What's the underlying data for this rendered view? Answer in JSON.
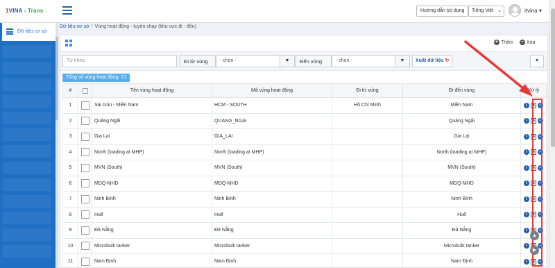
{
  "app": {
    "logo_prefix": "1",
    "logo_main": "VINA",
    "logo_suffix": "- Trans"
  },
  "header": {
    "guide_label": "Hướng dẫn sử dụng",
    "language": "Tiếng Việt",
    "username": "itvina",
    "username_caret": "▾"
  },
  "sidebar": {
    "active_label": "Dữ liệu cơ sở"
  },
  "breadcrumb": {
    "items": [
      "Dữ liệu cơ sở",
      "Vùng hoạt động - tuyến chạy (khu vực đi - đến)"
    ],
    "separator": "/"
  },
  "toolbar": {
    "add_label": "Thêm",
    "delete_label": "Xóa"
  },
  "filters": {
    "keyword_placeholder": "Từ khóa",
    "from_label": "Đi từ vùng",
    "from_value": "- chọn -",
    "to_label": "Đến vùng",
    "to_value": "- chọn -",
    "export_label": "Xuất dữ liệu"
  },
  "total_label": "Tổng số vùng hoạt động: 21",
  "table": {
    "headers": [
      "#",
      "",
      "Tên vùng hoạt động",
      "Mã vùng hoạt động",
      "Đi từ vùng",
      "Đi đến vùng",
      "Xử lý"
    ],
    "rows": [
      {
        "num": "1",
        "name": "Sài Gòn - Miền Nam",
        "code": "HCM - SOUTH",
        "from": "Hồ Chí Minh",
        "to": "Miền Nam"
      },
      {
        "num": "2",
        "name": "Quảng Ngãi",
        "code": "QUANG_NGAI",
        "from": "",
        "to": "Quảng Ngãi"
      },
      {
        "num": "3",
        "name": "Gia Lai",
        "code": "GIA_LAI",
        "from": "",
        "to": "Gia Lai"
      },
      {
        "num": "4",
        "name": "North (loading at MHP)",
        "code": "North (loading at MHP)",
        "from": "",
        "to": "North (loading at MHP)"
      },
      {
        "num": "5",
        "name": "MVN (South)",
        "code": "MVN (South)",
        "from": "",
        "to": "MVN (South)"
      },
      {
        "num": "6",
        "name": "MDQ-MHD",
        "code": "MDQ-MHD",
        "from": "",
        "to": "MDQ-MHD"
      },
      {
        "num": "7",
        "name": "Ninh Bình",
        "code": "Ninh Bình",
        "from": "",
        "to": "Ninh Bình"
      },
      {
        "num": "8",
        "name": "Huế",
        "code": "Huế",
        "from": "",
        "to": "Huế"
      },
      {
        "num": "9",
        "name": "Đà Nẵng",
        "code": "Đà Nẵng",
        "from": "",
        "to": "Đà Nẵng"
      },
      {
        "num": "10",
        "name": "Microbulk tanker",
        "code": "Microbulk tanker",
        "from": "",
        "to": "Microbulk tanker"
      },
      {
        "num": "11",
        "name": "Nam Định",
        "code": "Nam Định",
        "from": "",
        "to": "Nam Định"
      }
    ]
  },
  "colors": {
    "brand_blue": "#1f6fc5",
    "highlight_red": "#e53935",
    "badge_blue": "#5aaeea"
  },
  "icons": [
    "hamburger-icon",
    "list-icon",
    "grid-icon",
    "plus-circle-icon",
    "minus-circle-icon",
    "refresh-icon",
    "chevron-down-icon",
    "info-icon",
    "edit-icon",
    "remove-icon",
    "arrow-annotation"
  ]
}
